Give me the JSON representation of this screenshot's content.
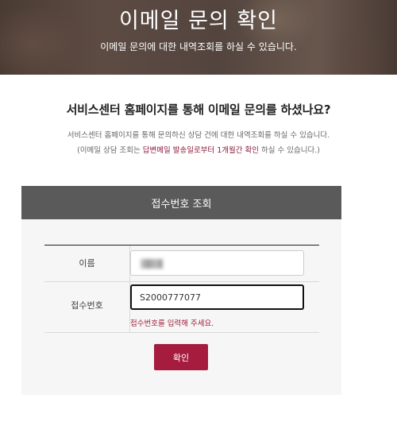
{
  "hero": {
    "title": "이메일 문의 확인",
    "subtitle": "이메일 문의에 대한 내역조회를 하실 수 있습니다."
  },
  "intro": {
    "question": "서비스센터 홈페이지를 통해 이메일 문의를 하셨나요?",
    "line1": "서비스센터 홈페이지를 통해 문의하신 상담 건에 대한 내역조회를 하실 수 있습니다.",
    "line2_before": "(이메일 상담 조회는 ",
    "line2_highlight": "답변메일 발송일로부터 1개월간 확인",
    "line2_after": " 하실 수 있습니다.)"
  },
  "form": {
    "header": "접수번호 조회",
    "name_label": "이름",
    "name_value": "",
    "number_label": "접수번호",
    "number_value": "S2000777077",
    "error_text": "접수번호를 입력해 주세요.",
    "confirm_label": "확인"
  },
  "colors": {
    "accent": "#a51c3e",
    "header_bg": "#5a5a5a",
    "error": "#a0213a",
    "highlight": "#8a1a3a"
  }
}
